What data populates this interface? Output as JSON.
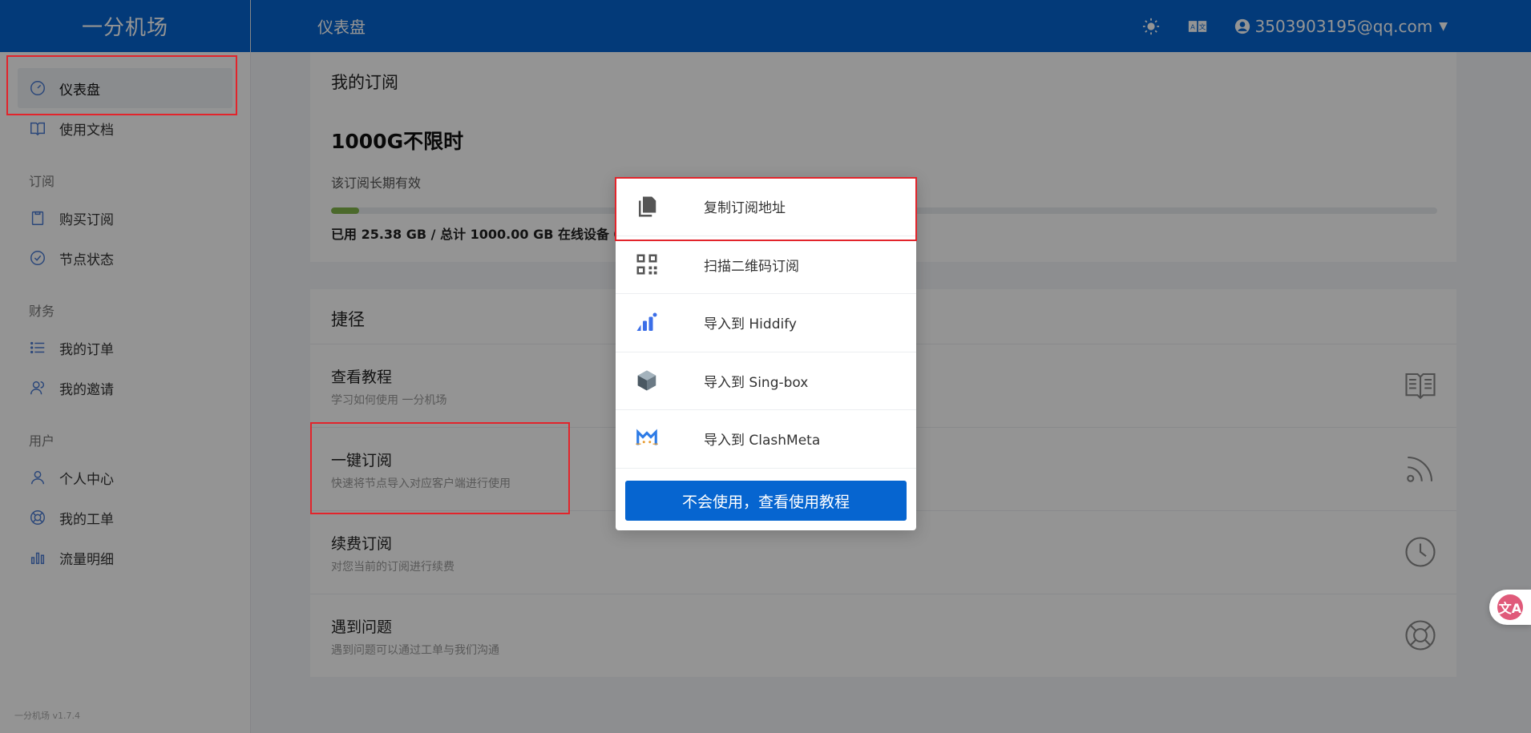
{
  "brand": "一分机场",
  "version": "一分机场 v1.7.4",
  "header": {
    "title": "仪表盘",
    "user_email": "3503903195@qq.com"
  },
  "sidebar": {
    "items": [
      {
        "label": "仪表盘",
        "icon": "dashboard-icon"
      },
      {
        "label": "使用文档",
        "icon": "book-icon"
      }
    ],
    "groups": [
      {
        "title": "订阅",
        "items": [
          {
            "label": "购买订阅",
            "icon": "clipboard-icon"
          },
          {
            "label": "节点状态",
            "icon": "check-circle-icon"
          }
        ]
      },
      {
        "title": "财务",
        "items": [
          {
            "label": "我的订单",
            "icon": "list-icon"
          },
          {
            "label": "我的邀请",
            "icon": "users-icon"
          }
        ]
      },
      {
        "title": "用户",
        "items": [
          {
            "label": "个人中心",
            "icon": "user-icon"
          },
          {
            "label": "我的工单",
            "icon": "lifebuoy-icon"
          },
          {
            "label": "流量明细",
            "icon": "bar-chart-icon"
          }
        ]
      }
    ]
  },
  "subscription": {
    "title": "我的订阅",
    "plan_name": "1000G不限时",
    "plan_desc": "该订阅长期有效",
    "usage_fraction": 0.025,
    "usage_text": "已用 25.38 GB / 总计 1000.00 GB 在线设备 0"
  },
  "shortcuts": {
    "title": "捷径",
    "items": [
      {
        "title": "查看教程",
        "desc": "学习如何使用 一分机场",
        "icon": "book-icon"
      },
      {
        "title": "一键订阅",
        "desc": "快速将节点导入对应客户端进行使用",
        "icon": "rss-icon"
      },
      {
        "title": "续费订阅",
        "desc": "对您当前的订阅进行续费",
        "icon": "clock-icon"
      },
      {
        "title": "遇到问题",
        "desc": "遇到问题可以通过工单与我们沟通",
        "icon": "lifebuoy-icon"
      }
    ]
  },
  "popup": {
    "items": [
      {
        "label": "复制订阅地址",
        "icon": "copy-icon"
      },
      {
        "label": "扫描二维码订阅",
        "icon": "qrcode-icon"
      },
      {
        "label": "导入到 Hiddify",
        "icon": "hiddify-icon"
      },
      {
        "label": "导入到 Sing-box",
        "icon": "singbox-icon"
      },
      {
        "label": "导入到 ClashMeta",
        "icon": "clashmeta-icon"
      }
    ],
    "button": "不会使用，查看使用教程"
  },
  "colors": {
    "primary": "#0665d0",
    "highlight": "#e2242b"
  }
}
